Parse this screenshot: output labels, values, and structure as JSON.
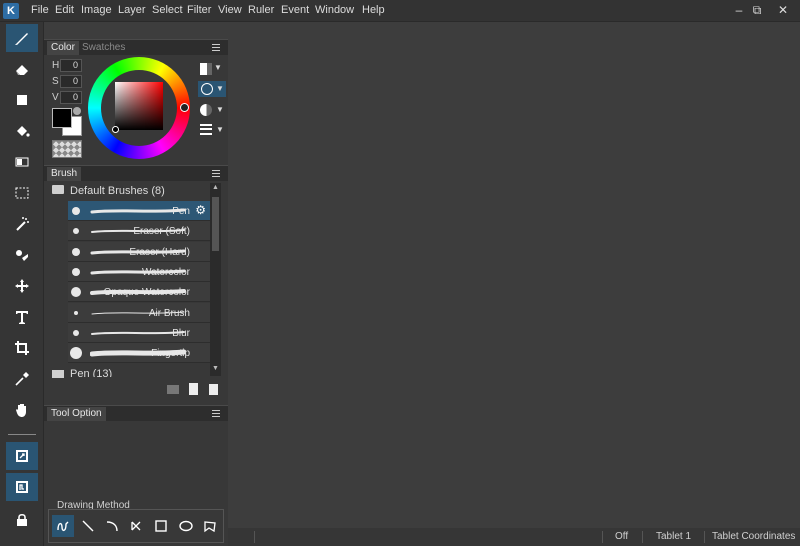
{
  "menu": [
    "File",
    "Edit",
    "Image",
    "Layer",
    "Select",
    "Filter",
    "View",
    "Ruler",
    "Event",
    "Window",
    "Help"
  ],
  "logo_text": "K",
  "window_controls": [
    "–",
    "⧉",
    "✕"
  ],
  "color_panel": {
    "tabs": [
      "Color",
      "Swatches"
    ],
    "hsv": [
      {
        "label": "H",
        "value": "0"
      },
      {
        "label": "S",
        "value": "0"
      },
      {
        "label": "V",
        "value": "0"
      }
    ],
    "fg_color": "#000000",
    "bg_color": "#ffffff",
    "hue_color": "#ff0000"
  },
  "brush_panel": {
    "tab": "Brush",
    "group": "Default Brushes (8)",
    "next_group": "Pen (13)",
    "brushes": [
      {
        "name": "Pen",
        "dot": 4,
        "selected": true
      },
      {
        "name": "Eraser (Soft)",
        "dot": 3,
        "selected": false
      },
      {
        "name": "Eraser (Hard)",
        "dot": 4,
        "selected": false
      },
      {
        "name": "Watercolor",
        "dot": 4,
        "selected": false
      },
      {
        "name": "Opaque Watercolor",
        "dot": 5,
        "selected": false
      },
      {
        "name": "Air Brush",
        "dot": 2,
        "selected": false
      },
      {
        "name": "Blur",
        "dot": 3,
        "selected": false
      },
      {
        "name": "Fingertip",
        "dot": 6,
        "selected": false
      }
    ]
  },
  "tool_option": {
    "tab": "Tool Option",
    "drawing_method_label": "Drawing Method"
  },
  "status": {
    "off": "Off",
    "tablet": "Tablet 1",
    "coords": "Tablet Coordinates"
  },
  "tools": [
    "brush-icon",
    "eraser-icon",
    "rectangle-fill-icon",
    "bucket-fill-icon",
    "gradient-icon",
    "selection-icon",
    "magic-wand-icon",
    "select-pen-icon",
    "move-icon",
    "text-icon",
    "crop-icon",
    "eyedropper-icon",
    "hand-icon",
    "color-mode-icon",
    "layer-mode-icon",
    "lock-icon"
  ]
}
